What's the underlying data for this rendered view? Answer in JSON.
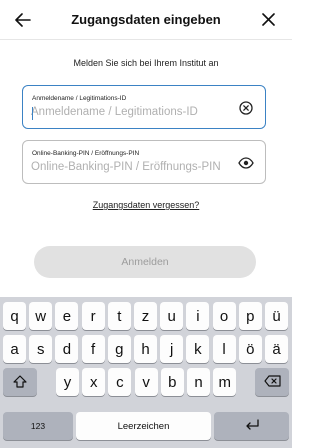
{
  "header": {
    "title": "Zugangsdaten eingeben",
    "back_icon": "arrow-left-icon",
    "close_icon": "close-icon"
  },
  "subtitle": "Melden Sie sich bei Ihrem Institut an",
  "login_field": {
    "label": "Anmeldename / Legitimations-ID",
    "placeholder": "Anmeldename / Legitimations-ID",
    "value": "",
    "clear_icon": "clear-circle-icon"
  },
  "pin_field": {
    "label": "Online-Banking-PIN / Eröffnungs-PIN",
    "placeholder": "Online-Banking-PIN / Eröffnungs-PIN",
    "value": "",
    "visibility_icon": "eye-icon"
  },
  "forgot_link": "Zugangsdaten vergessen?",
  "submit_label": "Anmelden",
  "keyboard": {
    "row1": [
      "q",
      "w",
      "e",
      "r",
      "t",
      "z",
      "u",
      "i",
      "o",
      "p",
      "ü"
    ],
    "row2": [
      "a",
      "s",
      "d",
      "f",
      "g",
      "h",
      "j",
      "k",
      "l",
      "ö",
      "ä"
    ],
    "row3": [
      "y",
      "x",
      "c",
      "v",
      "b",
      "n",
      "m"
    ],
    "numbers_label": "123",
    "space_label": "Leerzeichen",
    "shift_icon": "shift-icon",
    "backspace_icon": "backspace-icon",
    "return_icon": "return-icon"
  },
  "colors": {
    "accent": "#3b82c4",
    "button_disabled": "#e1e1e1",
    "keyboard_bg": "#d1d3d9"
  }
}
